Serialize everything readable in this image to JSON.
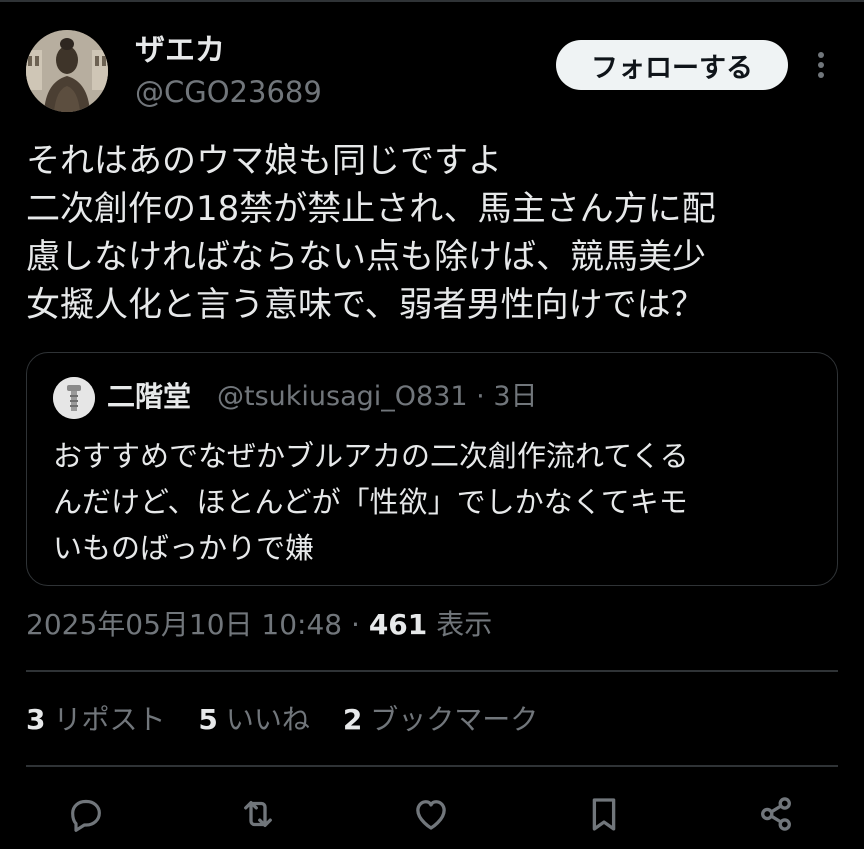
{
  "author": {
    "display_name": "ザエカ",
    "handle": "@CGO23689"
  },
  "follow_button_label": "フォローする",
  "tweet": {
    "lines": [
      "それはあのウマ娘も同じですよ",
      "二次創作の18禁が禁止され、馬主さん方に配",
      "慮しなければならない点も除けば、競馬美少",
      "女擬人化と言う意味で、弱者男性向けでは？"
    ]
  },
  "quote": {
    "display_name": "二階堂",
    "handle": "@tsukiusagi_O831",
    "separator": "·",
    "age": "3日",
    "lines": [
      "おすすめでなぜかブルアカの二次創作流れてくる",
      "んだけど、ほとんどが「性欲」でしかなくてキモ",
      "いものばっかりで嫌"
    ]
  },
  "meta": {
    "timestamp": "2025年05月10日 10:48",
    "separator": "·",
    "views_count": "461",
    "views_label": "表示"
  },
  "stats": {
    "reposts_count": "3",
    "reposts_label": "リポスト",
    "likes_count": "5",
    "likes_label": "いいね",
    "bookmarks_count": "2",
    "bookmarks_label": "ブックマーク"
  },
  "icons": {
    "more": "more-vertical-icon",
    "reply": "reply-icon",
    "repost": "repost-icon",
    "like": "heart-icon",
    "bookmark": "bookmark-icon",
    "share": "share-icon"
  },
  "colors": {
    "background": "#000000",
    "text_primary": "#e7e9ea",
    "text_secondary": "#71767b",
    "border": "#2f3336",
    "follow_bg": "#eff3f4"
  }
}
